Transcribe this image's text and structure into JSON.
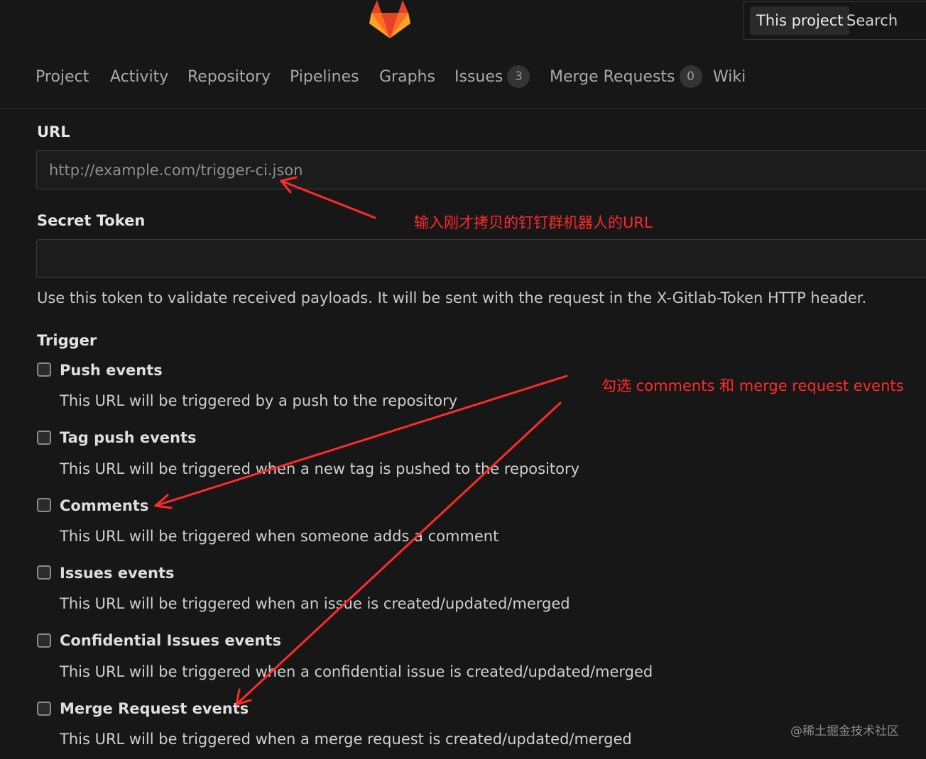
{
  "header": {
    "logo": "gitlab-logo",
    "search": {
      "scope": "This project",
      "placeholder": "Search"
    }
  },
  "nav": {
    "items": [
      {
        "label": "Project"
      },
      {
        "label": "Activity"
      },
      {
        "label": "Repository"
      },
      {
        "label": "Pipelines"
      },
      {
        "label": "Graphs"
      },
      {
        "label": "Issues",
        "count": "3"
      },
      {
        "label": "Merge Requests",
        "count": "0"
      },
      {
        "label": "Wiki"
      }
    ]
  },
  "form": {
    "url": {
      "label": "URL",
      "placeholder": "http://example.com/trigger-ci.json",
      "value": ""
    },
    "secret_token": {
      "label": "Secret Token",
      "value": "",
      "help": "Use this token to validate received payloads. It will be sent with the request in the X-Gitlab-Token HTTP header."
    },
    "trigger": {
      "label": "Trigger",
      "options": [
        {
          "label": "Push events",
          "help": "This URL will be triggered by a push to the repository",
          "checked": false
        },
        {
          "label": "Tag push events",
          "help": "This URL will be triggered when a new tag is pushed to the repository",
          "checked": false
        },
        {
          "label": "Comments",
          "help": "This URL will be triggered when someone adds a comment",
          "checked": false
        },
        {
          "label": "Issues events",
          "help": "This URL will be triggered when an issue is created/updated/merged",
          "checked": false
        },
        {
          "label": "Confidential Issues events",
          "help": "This URL will be triggered when a confidential issue is created/updated/merged",
          "checked": false
        },
        {
          "label": "Merge Request events",
          "help": "This URL will be triggered when a merge request is created/updated/merged",
          "checked": false
        }
      ]
    }
  },
  "annotations": {
    "url_note": "输入刚才拷贝的钉钉群机器人的URL",
    "trigger_note": "勾选 comments 和 merge request events",
    "color": "#ff2a2a"
  },
  "watermark": "@稀土掘金技术社区",
  "colors": {
    "background": "#171717",
    "logo_orange": "#e24329",
    "logo_light": "#fc6d26",
    "logo_yellow": "#fca326"
  }
}
